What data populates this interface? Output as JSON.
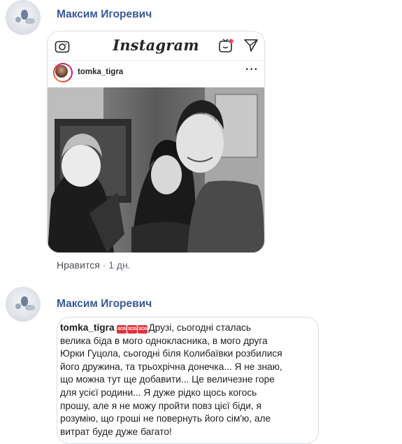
{
  "comment1": {
    "author": "Максим Игоревич",
    "instagram": {
      "logo_text": "Instagram",
      "username": "tomka_tigra",
      "more": "···"
    },
    "like_label": "Нравится",
    "separator": "·",
    "time": "1 дн."
  },
  "comment2": {
    "author": "Максим Игоревич",
    "username": "tomka_tigra",
    "badges": [
      "SOS",
      "SOS",
      "SOS"
    ],
    "lines": [
      "Друзі, сьогодні сталась",
      "велика біда в мого однокласника, в мого друга",
      "Юрки Гуцола, сьогодні біля Колибаївки розбилися",
      "його дружина, та трьохрічна донечка... Я не знаю,",
      "що можна тут ще добавити... Це величезне горе",
      "для усієї родини... Я дуже рідко щось когось",
      "прошу, але я не можу пройти повз цієї біди, я",
      "розумію, що гроші не повернуть його сім'ю, але",
      "витрат буде дуже багато!"
    ]
  },
  "colors": {
    "author_link": "#385898",
    "meta_text": "#606770",
    "sos_badge": "#e0313a"
  }
}
